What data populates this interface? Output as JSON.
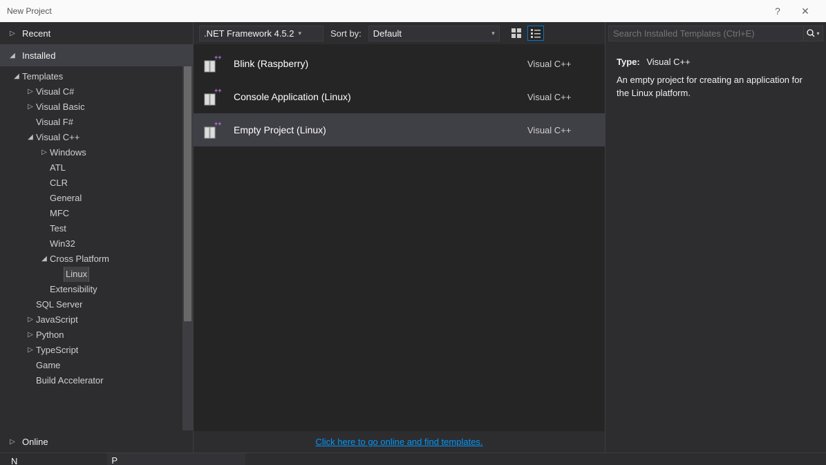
{
  "window": {
    "title": "New Project",
    "help": "?",
    "close": "✕"
  },
  "sidebar": {
    "sections": {
      "recent": "Recent",
      "installed": "Installed",
      "online": "Online"
    },
    "tree": [
      {
        "label": "Templates",
        "depth": 0,
        "arrow": "down"
      },
      {
        "label": "Visual C#",
        "depth": 1,
        "arrow": "right"
      },
      {
        "label": "Visual Basic",
        "depth": 1,
        "arrow": "right"
      },
      {
        "label": "Visual F#",
        "depth": 1,
        "arrow": "none"
      },
      {
        "label": "Visual C++",
        "depth": 1,
        "arrow": "down"
      },
      {
        "label": "Windows",
        "depth": 2,
        "arrow": "right"
      },
      {
        "label": "ATL",
        "depth": 2,
        "arrow": "none"
      },
      {
        "label": "CLR",
        "depth": 2,
        "arrow": "none"
      },
      {
        "label": "General",
        "depth": 2,
        "arrow": "none"
      },
      {
        "label": "MFC",
        "depth": 2,
        "arrow": "none"
      },
      {
        "label": "Test",
        "depth": 2,
        "arrow": "none"
      },
      {
        "label": "Win32",
        "depth": 2,
        "arrow": "none"
      },
      {
        "label": "Cross Platform",
        "depth": 2,
        "arrow": "down"
      },
      {
        "label": "Linux",
        "depth": 3,
        "arrow": "none",
        "selected": true
      },
      {
        "label": "Extensibility",
        "depth": 2,
        "arrow": "none"
      },
      {
        "label": "SQL Server",
        "depth": 1,
        "arrow": "none"
      },
      {
        "label": "JavaScript",
        "depth": 1,
        "arrow": "right"
      },
      {
        "label": "Python",
        "depth": 1,
        "arrow": "right"
      },
      {
        "label": "TypeScript",
        "depth": 1,
        "arrow": "right"
      },
      {
        "label": "Game",
        "depth": 1,
        "arrow": "none"
      },
      {
        "label": "Build Accelerator",
        "depth": 1,
        "arrow": "none"
      }
    ]
  },
  "center": {
    "framework_label": ".NET Framework 4.5.2",
    "sort_label": "Sort by:",
    "sort_value": "Default",
    "templates": [
      {
        "name": "Blink (Raspberry)",
        "lang": "Visual C++",
        "selected": false
      },
      {
        "name": "Console Application (Linux)",
        "lang": "Visual C++",
        "selected": false
      },
      {
        "name": "Empty Project (Linux)",
        "lang": "Visual C++",
        "selected": true
      }
    ],
    "online_link": "Click here to go online and find templates."
  },
  "right": {
    "search_placeholder": "Search Installed Templates (Ctrl+E)",
    "type_label": "Type:",
    "type_value": "Visual C++",
    "description": "An empty project for creating an application for the Linux platform."
  },
  "bottom": {
    "name_label": "N",
    "name_value": "P"
  }
}
